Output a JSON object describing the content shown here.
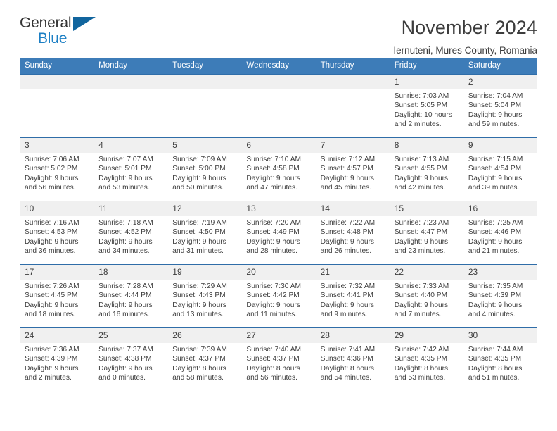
{
  "brand": {
    "line1": "General",
    "line2": "Blue",
    "accent_color": "#11659e",
    "text_color": "#333333"
  },
  "header": {
    "title": "November 2024",
    "subtitle": "Iernuteni, Mures County, Romania"
  },
  "theme": {
    "header_bg": "#3d7cb8",
    "row_border": "#2f6da8",
    "daynum_bg": "#f0f0f0",
    "text": "#3d3d3d"
  },
  "labels": {
    "sunrise_prefix": "Sunrise:",
    "sunset_prefix": "Sunset:",
    "daylight_prefix": "Daylight:"
  },
  "weekday_headers": [
    "Sunday",
    "Monday",
    "Tuesday",
    "Wednesday",
    "Thursday",
    "Friday",
    "Saturday"
  ],
  "weeks": [
    [
      {
        "day": "",
        "blank": true
      },
      {
        "day": "",
        "blank": true
      },
      {
        "day": "",
        "blank": true
      },
      {
        "day": "",
        "blank": true
      },
      {
        "day": "",
        "blank": true
      },
      {
        "day": "1",
        "sunrise": "Sunrise: 7:03 AM",
        "sunset": "Sunset: 5:05 PM",
        "daylight": "Daylight: 10 hours and 2 minutes."
      },
      {
        "day": "2",
        "sunrise": "Sunrise: 7:04 AM",
        "sunset": "Sunset: 5:04 PM",
        "daylight": "Daylight: 9 hours and 59 minutes."
      }
    ],
    [
      {
        "day": "3",
        "sunrise": "Sunrise: 7:06 AM",
        "sunset": "Sunset: 5:02 PM",
        "daylight": "Daylight: 9 hours and 56 minutes."
      },
      {
        "day": "4",
        "sunrise": "Sunrise: 7:07 AM",
        "sunset": "Sunset: 5:01 PM",
        "daylight": "Daylight: 9 hours and 53 minutes."
      },
      {
        "day": "5",
        "sunrise": "Sunrise: 7:09 AM",
        "sunset": "Sunset: 5:00 PM",
        "daylight": "Daylight: 9 hours and 50 minutes."
      },
      {
        "day": "6",
        "sunrise": "Sunrise: 7:10 AM",
        "sunset": "Sunset: 4:58 PM",
        "daylight": "Daylight: 9 hours and 47 minutes."
      },
      {
        "day": "7",
        "sunrise": "Sunrise: 7:12 AM",
        "sunset": "Sunset: 4:57 PM",
        "daylight": "Daylight: 9 hours and 45 minutes."
      },
      {
        "day": "8",
        "sunrise": "Sunrise: 7:13 AM",
        "sunset": "Sunset: 4:55 PM",
        "daylight": "Daylight: 9 hours and 42 minutes."
      },
      {
        "day": "9",
        "sunrise": "Sunrise: 7:15 AM",
        "sunset": "Sunset: 4:54 PM",
        "daylight": "Daylight: 9 hours and 39 minutes."
      }
    ],
    [
      {
        "day": "10",
        "sunrise": "Sunrise: 7:16 AM",
        "sunset": "Sunset: 4:53 PM",
        "daylight": "Daylight: 9 hours and 36 minutes."
      },
      {
        "day": "11",
        "sunrise": "Sunrise: 7:18 AM",
        "sunset": "Sunset: 4:52 PM",
        "daylight": "Daylight: 9 hours and 34 minutes."
      },
      {
        "day": "12",
        "sunrise": "Sunrise: 7:19 AM",
        "sunset": "Sunset: 4:50 PM",
        "daylight": "Daylight: 9 hours and 31 minutes."
      },
      {
        "day": "13",
        "sunrise": "Sunrise: 7:20 AM",
        "sunset": "Sunset: 4:49 PM",
        "daylight": "Daylight: 9 hours and 28 minutes."
      },
      {
        "day": "14",
        "sunrise": "Sunrise: 7:22 AM",
        "sunset": "Sunset: 4:48 PM",
        "daylight": "Daylight: 9 hours and 26 minutes."
      },
      {
        "day": "15",
        "sunrise": "Sunrise: 7:23 AM",
        "sunset": "Sunset: 4:47 PM",
        "daylight": "Daylight: 9 hours and 23 minutes."
      },
      {
        "day": "16",
        "sunrise": "Sunrise: 7:25 AM",
        "sunset": "Sunset: 4:46 PM",
        "daylight": "Daylight: 9 hours and 21 minutes."
      }
    ],
    [
      {
        "day": "17",
        "sunrise": "Sunrise: 7:26 AM",
        "sunset": "Sunset: 4:45 PM",
        "daylight": "Daylight: 9 hours and 18 minutes."
      },
      {
        "day": "18",
        "sunrise": "Sunrise: 7:28 AM",
        "sunset": "Sunset: 4:44 PM",
        "daylight": "Daylight: 9 hours and 16 minutes."
      },
      {
        "day": "19",
        "sunrise": "Sunrise: 7:29 AM",
        "sunset": "Sunset: 4:43 PM",
        "daylight": "Daylight: 9 hours and 13 minutes."
      },
      {
        "day": "20",
        "sunrise": "Sunrise: 7:30 AM",
        "sunset": "Sunset: 4:42 PM",
        "daylight": "Daylight: 9 hours and 11 minutes."
      },
      {
        "day": "21",
        "sunrise": "Sunrise: 7:32 AM",
        "sunset": "Sunset: 4:41 PM",
        "daylight": "Daylight: 9 hours and 9 minutes."
      },
      {
        "day": "22",
        "sunrise": "Sunrise: 7:33 AM",
        "sunset": "Sunset: 4:40 PM",
        "daylight": "Daylight: 9 hours and 7 minutes."
      },
      {
        "day": "23",
        "sunrise": "Sunrise: 7:35 AM",
        "sunset": "Sunset: 4:39 PM",
        "daylight": "Daylight: 9 hours and 4 minutes."
      }
    ],
    [
      {
        "day": "24",
        "sunrise": "Sunrise: 7:36 AM",
        "sunset": "Sunset: 4:39 PM",
        "daylight": "Daylight: 9 hours and 2 minutes."
      },
      {
        "day": "25",
        "sunrise": "Sunrise: 7:37 AM",
        "sunset": "Sunset: 4:38 PM",
        "daylight": "Daylight: 9 hours and 0 minutes."
      },
      {
        "day": "26",
        "sunrise": "Sunrise: 7:39 AM",
        "sunset": "Sunset: 4:37 PM",
        "daylight": "Daylight: 8 hours and 58 minutes."
      },
      {
        "day": "27",
        "sunrise": "Sunrise: 7:40 AM",
        "sunset": "Sunset: 4:37 PM",
        "daylight": "Daylight: 8 hours and 56 minutes."
      },
      {
        "day": "28",
        "sunrise": "Sunrise: 7:41 AM",
        "sunset": "Sunset: 4:36 PM",
        "daylight": "Daylight: 8 hours and 54 minutes."
      },
      {
        "day": "29",
        "sunrise": "Sunrise: 7:42 AM",
        "sunset": "Sunset: 4:35 PM",
        "daylight": "Daylight: 8 hours and 53 minutes."
      },
      {
        "day": "30",
        "sunrise": "Sunrise: 7:44 AM",
        "sunset": "Sunset: 4:35 PM",
        "daylight": "Daylight: 8 hours and 51 minutes."
      }
    ]
  ]
}
